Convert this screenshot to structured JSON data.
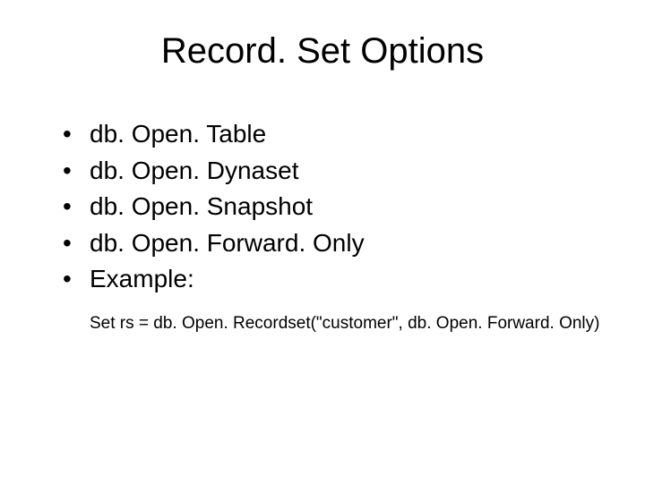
{
  "slide": {
    "title": "Record. Set Options",
    "bullets": [
      "db. Open. Table",
      "db. Open. Dynaset",
      "db. Open. Snapshot",
      "db. Open. Forward. Only",
      "Example:"
    ],
    "code": "Set rs = db. Open. Recordset(\"customer\", db. Open. Forward. Only)"
  }
}
